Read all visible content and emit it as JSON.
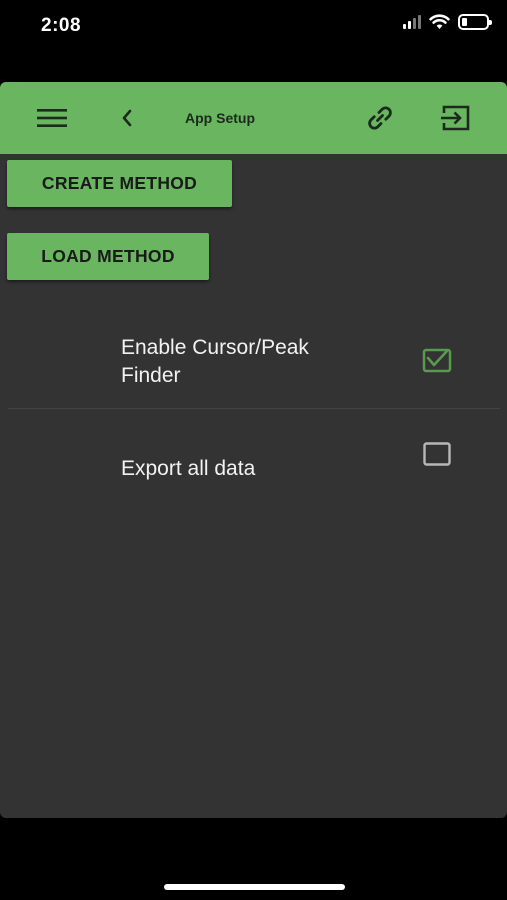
{
  "status_bar": {
    "time": "2:08",
    "icons": [
      "cellular-signal-icon",
      "wifi-icon",
      "battery-icon"
    ]
  },
  "app_bar": {
    "title": "App Setup",
    "icons": [
      "menu-icon",
      "back-chevron-icon",
      "link-icon",
      "exit-icon"
    ]
  },
  "actions": {
    "create_method": "CREATE METHOD",
    "load_method": "LOAD METHOD"
  },
  "settings": [
    {
      "label": "Enable Cursor/Peak Finder",
      "checked": true
    },
    {
      "label": "Export all data",
      "checked": false
    }
  ],
  "colors": {
    "accent": "#69b560",
    "background": "#333333",
    "checkbox_checked": "#5a9a4f",
    "checkbox_unchecked": "#b8b8b8"
  }
}
